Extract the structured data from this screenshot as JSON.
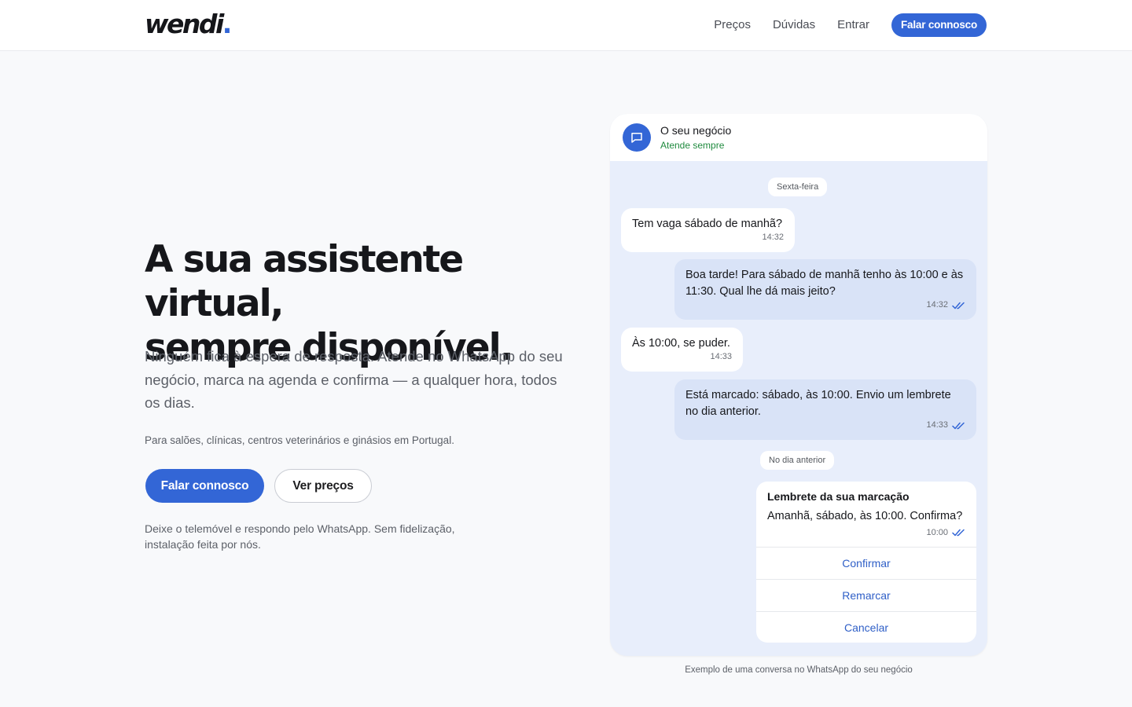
{
  "brand": {
    "name": "wendi",
    "dot": ".",
    "accent": "#3366d6"
  },
  "nav": {
    "links": [
      "Preços",
      "Dúvidas",
      "Entrar"
    ],
    "cta": "Falar connosco"
  },
  "hero": {
    "title_line1": "A sua assistente virtual,",
    "title_line2": "sempre disponível.",
    "subtitle": "Ninguém fica à espera de resposta. Atende no WhatsApp do seu negócio, marca na agenda e confirma — a qualquer hora, todos os dias.",
    "audience": "Para salões, clínicas, centros veterinários e ginásios em Portugal.",
    "primary_button": "Falar connosco",
    "secondary_button": "Ver preços",
    "footnote": "Deixe o telemóvel e respondo pelo WhatsApp. Sem fidelização, instalação feita por nós."
  },
  "chat": {
    "name": "O seu negócio",
    "status": "Atende sempre",
    "status_color": "#1f8a3e",
    "day1": "Sexta-feira",
    "messages": [
      {
        "dir": "in",
        "text": "Tem vaga sábado de manhã?",
        "time": "14:32"
      },
      {
        "dir": "out",
        "text": "Boa tarde! Para sábado de manhã tenho às 10:00 e às 11:30. Qual lhe dá mais jeito?",
        "time": "14:32"
      },
      {
        "dir": "in",
        "text": "Às 10:00, se puder.",
        "time": "14:33"
      },
      {
        "dir": "out",
        "text": "Está marcado: sábado, às 10:00. Envio um lembrete no dia anterior.",
        "time": "14:33"
      }
    ],
    "day2": "No dia anterior",
    "reminder": {
      "title": "Lembrete da sua marcação",
      "body": "Amanhã, sábado, às 10:00. Confirma?",
      "time": "10:00",
      "actions": [
        "Confirmar",
        "Remarcar",
        "Cancelar"
      ]
    },
    "caption": "Exemplo de uma conversa no WhatsApp do seu negócio"
  }
}
